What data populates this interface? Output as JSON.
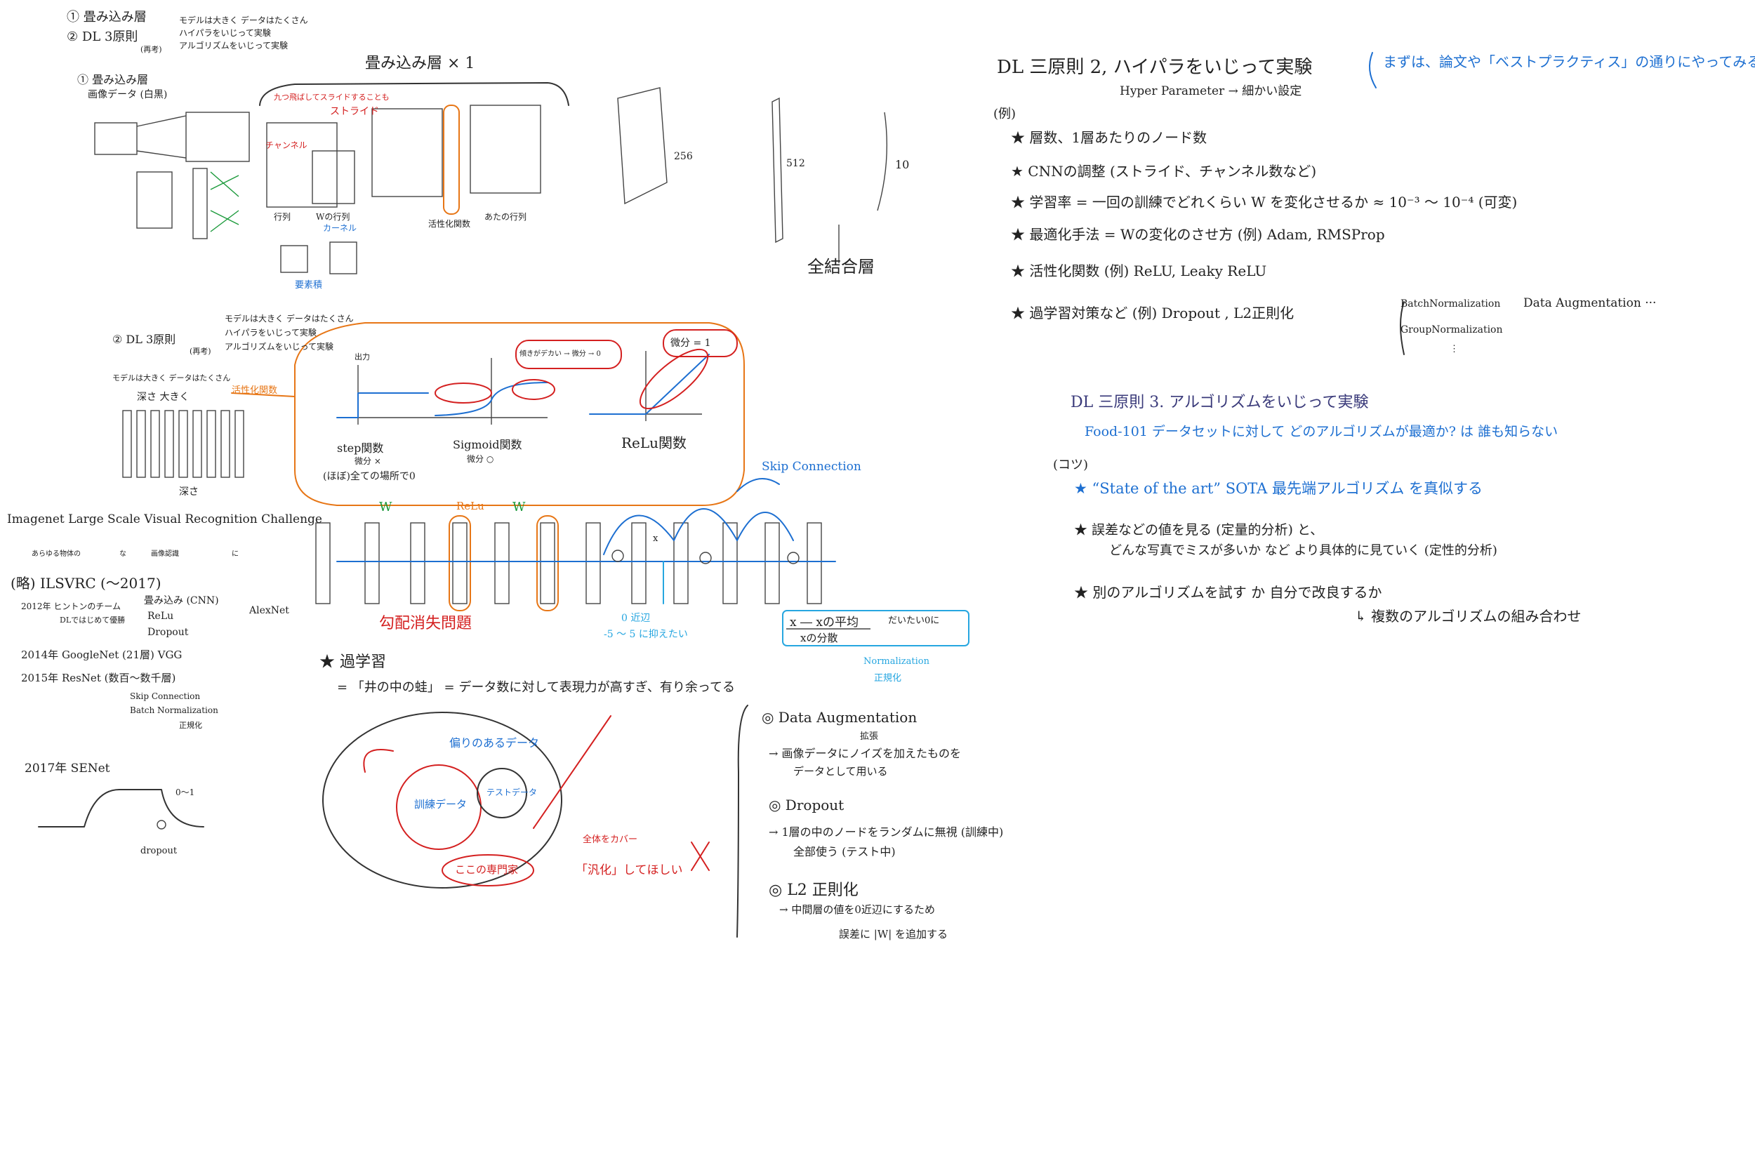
{
  "left_top": {
    "line1": "① 畳み込み層",
    "line2_head": "② DL 3原則",
    "line2_sub": "(再考)",
    "line2_rules": [
      "モデルは大きく データはたくさん",
      "ハイパラをいじって実験",
      "アルゴリズムをいじって実験"
    ],
    "conv_title": "① 畳み込み層",
    "conv_sub": "画像データ (白黒)",
    "conv_layer_label": "畳み込み層 × 1",
    "stride_note": "九つ飛ばしてスライドすることも",
    "stride_label": "ストライド",
    "channel_label": "チャンネル",
    "kernel_label": "カーネル",
    "matrix_label": "行列",
    "w_matrix_label": "Wの行列",
    "activation_label": "活性化関数",
    "result_label": "あたの行列",
    "elementwise_label": "要素積",
    "fc_label": "全結合層",
    "num_256": "256",
    "num_512": "512",
    "num_10": "10"
  },
  "left_mid": {
    "rule_head": "② DL 3原則",
    "rule_sub": "(再考)",
    "rules": [
      "モデルは大きく データはたくさん",
      "ハイパラをいじって実験",
      "アルゴリズムをいじって実験"
    ],
    "model_note": "モデルは大きく データはたくさん",
    "depth_label": "深さ 大きく",
    "depth_bottom": "深さ",
    "activation_orange": "活性化関数",
    "output_axis": "出力",
    "step_label": "step関数",
    "step_note1": "微分 ×",
    "step_note2": "(ほぼ)全ての場所で0",
    "sigmoid_label": "Sigmoid関数",
    "sigmoid_note": "微分 ○",
    "sigmoid_bubble": "傾きがデカい → 微分 → 0",
    "relu_label": "ReLu関数",
    "relu_bubble": "微分 = 1"
  },
  "imagenet": {
    "title": "Imagenet Large Scale Visual Recognition Challenge",
    "sub1": "あらゆる物体の",
    "sub2": "な",
    "sub3": "画像認識",
    "sub4": "に",
    "abbr": "(略) ILSVRC (〜2017)",
    "y2012": "2012年 ヒントンのチーム",
    "y2012b": "DLではじめて優勝",
    "y2012_items": [
      "畳み込み (CNN)",
      "ReLu",
      "Dropout"
    ],
    "alexnet": "AlexNet",
    "y2014": "2014年 GoogleNet (21層) VGG",
    "y2015": "2015年 ResNet (数百〜数千層)",
    "skip": "Skip Connection",
    "batchnorm": "Batch Normalization",
    "seikika": "正規化",
    "y2017": "2017年 SENet",
    "range": "0〜1",
    "dropout": "dropout"
  },
  "center_mid": {
    "skip_connection": "Skip Connection",
    "w1": "W",
    "w2": "W",
    "relu": "ReLu",
    "vanishing": "勾配消失問題",
    "zero_near": "0 近辺",
    "range_note": "-5 〜 5 に抑えたい",
    "formula_num": "x ― xの平均",
    "formula_den": "xの分散",
    "formula_note": "だいたい0に",
    "normalization": "Normalization",
    "normalization_jp": "正規化",
    "x_label": "x"
  },
  "overfit": {
    "title": "★ 過学習",
    "desc": "= 「井の中の蛙」 = データ数に対して表現力が高すぎ、有り余ってる",
    "biased": "偏りのあるデータ",
    "train": "訓練データ",
    "test": "テストデータ",
    "only_here": "ここの専門家",
    "cover": "全体をカバー",
    "generalize": "「汎化」してほしい",
    "da_title": "◎ Data Augmentation",
    "da_jp": "拡張",
    "da_desc1": "→ 画像データにノイズを加えたものを",
    "da_desc2": "データとして用いる",
    "do_title": "◎ Dropout",
    "do_desc1": "→ 1層の中のノードをランダムに無視 (訓練中)",
    "do_desc2": "全部使う (テスト中)",
    "l2_title": "◎ L2 正則化",
    "l2_desc1": "→ 中間層の値を0近辺にするため",
    "l2_desc2": "誤差に |W| を追加する"
  },
  "right": {
    "rule2": "DL 三原則 2, ハイパラをいじって実験",
    "hyper": "Hyper Parameter → 細かい設定",
    "blue_note": "まずは、論文や「ベストプラクティス」の通りにやってみる!",
    "example": "(例)",
    "items": [
      "★ 層数、1層あたりのノード数",
      "★ CNNの調整 (ストライド、チャンネル数など)",
      "★ 学習率 = 一回の訓練でどれくらい W を変化させるか ≈ 10⁻³ 〜 10⁻⁴ (可変)",
      "★ 最適化手法 = Wの変化のさせ方 (例) Adam, RMSProp",
      "★ 活性化関数 (例) ReLU, Leaky ReLU",
      "★ 過学習対策など (例) Dropout , L2正則化"
    ],
    "norm_list": [
      "BatchNormalization",
      "GroupNormalization",
      "⋮"
    ],
    "data_aug": "Data Augmentation ···",
    "rule3": "DL 三原則 3. アルゴリズムをいじって実験",
    "food": "Food-101 データセットに対して どのアルゴリズムが最適か? は 誰も知らない",
    "kotsu": "(コツ)",
    "tips": [
      "★ “State of the art” SOTA 最先端アルゴリズム を真似する",
      "★ 誤差などの値を見る (定量的分析) と、",
      "どんな写真でミスが多いか など より具体的に見ていく (定性的分析)",
      "★ 別のアルゴリズムを試す か 自分で改良するか",
      "↳ 複数のアルゴリズムの組み合わせ"
    ]
  },
  "colors": {
    "ink": "#222222",
    "blue": "#1d6fd1",
    "red": "#d42020",
    "orange": "#e77616",
    "green": "#1b9a3b",
    "cyan": "#26a6e0"
  }
}
